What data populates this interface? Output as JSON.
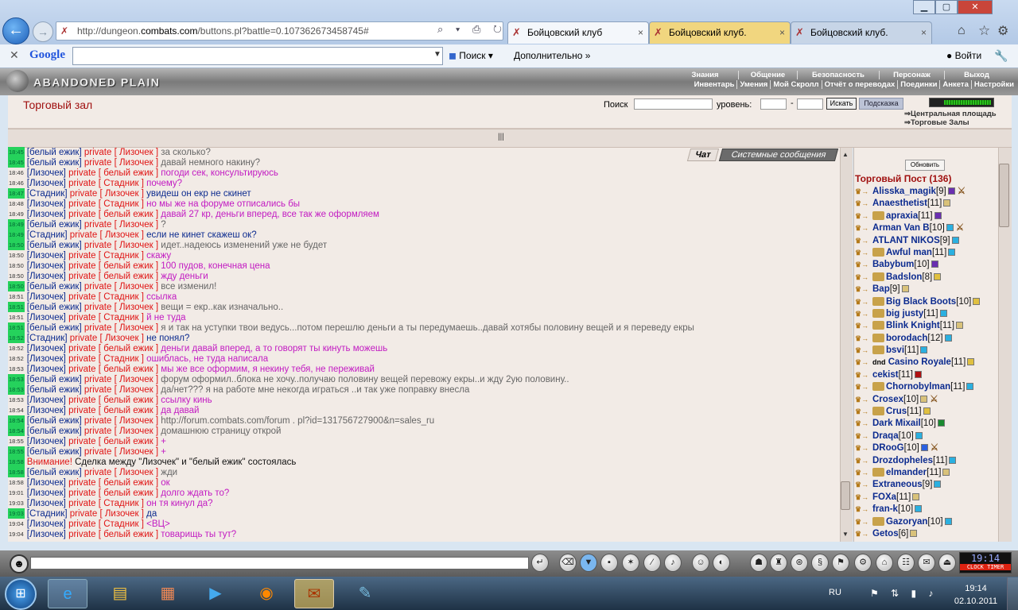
{
  "browser": {
    "url_prefix": "http://dungeon.",
    "url_domain": "combats.com",
    "url_suffix": "/buttons.pl?battle=0.107362673458745#",
    "tabs": [
      {
        "label": "Бойцовский клуб"
      },
      {
        "label": "Бойцовский клуб."
      },
      {
        "label": "Бойцовский клуб."
      }
    ]
  },
  "google": {
    "logo": "Google",
    "search_label": "Поиск",
    "more_label": "Дополнительно",
    "login_label": "Войти"
  },
  "game": {
    "logo": "ABANDONED PLAIN",
    "menu_top": [
      "Знания",
      "Общение",
      "Безопасность",
      "Персонаж",
      "Выход"
    ],
    "menu_bottom": [
      "Инвентарь",
      "Умения",
      "Мой Скролл",
      "Отчёт о переводах",
      "Поединки",
      "Анкета",
      "Настройки"
    ],
    "room_title": "Торговый зал",
    "search_label": "Поиск",
    "level_label": "уровень:",
    "dash": "-",
    "find_button": "Искать",
    "hint_button": "Подсказка",
    "link_central": "Центральная площадь",
    "link_trade": "Торговые Залы",
    "hp_fraction": 0.95,
    "chat_tab": "Чат",
    "system_tab": "Системные сообщения",
    "refresh_button": "Обновить",
    "players_title": "Торговый Пост (136)"
  },
  "chat": [
    {
      "t": "18:45",
      "a": "белый ежик",
      "b": "Лизочек",
      "m": "за сколько?",
      "c": "mg",
      "g": true
    },
    {
      "t": "18:45",
      "a": "белый ежик",
      "b": "Лизочек",
      "m": "давай немного накину?",
      "c": "mg",
      "g": true
    },
    {
      "t": "18:46",
      "a": "Лизочек",
      "b": "белый ежик",
      "m": "погоди сек, консультируюсь",
      "c": "mv",
      "g": false
    },
    {
      "t": "18:46",
      "a": "Лизочек",
      "b": "Стадник",
      "m": "почему?",
      "c": "mv",
      "g": false
    },
    {
      "t": "18:47",
      "a": "Стадник",
      "b": "Лизочек",
      "m": "увидеш он екр не скинет",
      "c": "ms",
      "g": true
    },
    {
      "t": "18:48",
      "a": "Лизочек",
      "b": "Стадник",
      "m": "но мы же на форуме отписались бы",
      "c": "mv",
      "g": false
    },
    {
      "t": "18:49",
      "a": "Лизочек",
      "b": "белый ежик",
      "m": "давай 27 кр, деньги вперед, все так же оформляем",
      "c": "mv",
      "g": false
    },
    {
      "t": "18:49",
      "a": "белый ежик",
      "b": "Лизочек",
      "m": "?",
      "c": "mg",
      "g": true
    },
    {
      "t": "18:49",
      "a": "Стадник",
      "b": "Лизочек",
      "m": "если не кинет скажеш ок?",
      "c": "ms",
      "g": true
    },
    {
      "t": "18:50",
      "a": "белый ежик",
      "b": "Лизочек",
      "m": "идет..надеюсь изменений уже не будет",
      "c": "mg",
      "g": true
    },
    {
      "t": "18:50",
      "a": "Лизочек",
      "b": "Стадник",
      "m": "скажу",
      "c": "mv",
      "g": false
    },
    {
      "t": "18:50",
      "a": "Лизочек",
      "b": "белый ежик",
      "m": "100 пудов, конечная цена",
      "c": "mv",
      "g": false
    },
    {
      "t": "18:50",
      "a": "Лизочек",
      "b": "белый ежик",
      "m": "жду деньги",
      "c": "mv",
      "g": false
    },
    {
      "t": "18:50",
      "a": "белый ежик",
      "b": "Лизочек",
      "m": "все изменил!",
      "c": "mg",
      "g": true
    },
    {
      "t": "18:51",
      "a": "Лизочек",
      "b": "Стадник",
      "m": "ссылка",
      "c": "mv",
      "g": false
    },
    {
      "t": "18:51",
      "a": "белый ежик",
      "b": "Лизочек",
      "m": "вещи = екр..как изначально..",
      "c": "mg",
      "g": true
    },
    {
      "t": "18:51",
      "a": "Лизочек",
      "b": "Стадник",
      "m": "й не туда",
      "c": "mv",
      "g": false
    },
    {
      "t": "18:51",
      "a": "белый ежик",
      "b": "Лизочек",
      "m": "я и так на уступки твои ведусь...потом перешлю деньги а ты передумаешь..давай хотябы половину вещей и я переведу екры",
      "c": "mg",
      "g": true
    },
    {
      "t": "18:52",
      "a": "Стадник",
      "b": "Лизочек",
      "m": "не понял?",
      "c": "ms",
      "g": true
    },
    {
      "t": "18:52",
      "a": "Лизочек",
      "b": "белый ежик",
      "m": "деньги давай вперед, а то говорят ты кинуть можешь",
      "c": "mv",
      "g": false
    },
    {
      "t": "18:52",
      "a": "Лизочек",
      "b": "Стадник",
      "m": "ошиблась, не туда написала",
      "c": "mv",
      "g": false
    },
    {
      "t": "18:53",
      "a": "Лизочек",
      "b": "белый ежик",
      "m": "мы же все оформим, я некину тебя, не переживай",
      "c": "mv",
      "g": false
    },
    {
      "t": "18:53",
      "a": "белый ежик",
      "b": "Лизочек",
      "m": "форум оформил..блока не хочу..получаю половину вещей перевожу екры..и жду 2ую половину..",
      "c": "mg",
      "g": true
    },
    {
      "t": "18:53",
      "a": "белый ежик",
      "b": "Лизочек",
      "m": "да/нет??? я на работе мне некогда играться ..и так уже поправку внесла",
      "c": "mg",
      "g": true
    },
    {
      "t": "18:53",
      "a": "Лизочек",
      "b": "белый ежик",
      "m": "ссылку кинь",
      "c": "mv",
      "g": false
    },
    {
      "t": "18:54",
      "a": "Лизочек",
      "b": "белый ежик",
      "m": "да давай",
      "c": "mv",
      "g": false
    },
    {
      "t": "18:54",
      "a": "белый ежик",
      "b": "Лизочек",
      "m": "http://forum.combats.com/forum . pl?id=131756727900&n=sales_ru",
      "c": "mg",
      "g": true
    },
    {
      "t": "18:54",
      "a": "белый ежик",
      "b": "Лизочек",
      "m": "домашнюю страницу открой",
      "c": "mg",
      "g": true
    },
    {
      "t": "18:55",
      "a": "Лизочек",
      "b": "белый ежик",
      "m": "+",
      "c": "mv",
      "g": false
    },
    {
      "t": "18:55",
      "a": "белый ежик",
      "b": "Лизочек",
      "m": "+",
      "c": "mv",
      "g": true
    },
    {
      "t": "18:58",
      "warn": "Внимание!",
      "m": "Сделка между \"Лизочек\" и \"белый ежик\" состоялась",
      "c": "ms2",
      "g": true
    },
    {
      "t": "18:58",
      "a": "белый ежик",
      "b": "Лизочек",
      "m": "жди",
      "c": "mg",
      "g": true
    },
    {
      "t": "18:58",
      "a": "Лизочек",
      "b": "белый ежик",
      "m": "ок",
      "c": "mv",
      "g": false
    },
    {
      "t": "19:01",
      "a": "Лизочек",
      "b": "белый ежик",
      "m": "долго ждать то?",
      "c": "mv",
      "g": false
    },
    {
      "t": "19:03",
      "a": "Лизочек",
      "b": "Стадник",
      "m": "он тя кинул да?",
      "c": "mv",
      "g": false
    },
    {
      "t": "19:03",
      "a": "Стадник",
      "b": "Лизочек",
      "m": "да",
      "c": "ms",
      "g": true
    },
    {
      "t": "19:04",
      "a": "Лизочек",
      "b": "Стадник",
      "m": "<ВЦ>",
      "c": "mv",
      "g": false
    },
    {
      "t": "19:04",
      "a": "Лизочек",
      "b": "белый ежик",
      "m": "товарищь ты тут?",
      "c": "mv",
      "g": false
    }
  ],
  "chat_labels": {
    "private": "private"
  },
  "players": [
    {
      "n": "Aliss­ka_magik",
      "l": "[9]",
      "s": "#6a2fb0",
      "sw": true
    },
    {
      "n": "Anaesthetist",
      "l": "[11]",
      "s": "#d9c27a"
    },
    {
      "n": "apraxia",
      "l": "[11]",
      "s": "#6a2fb0",
      "cl": true
    },
    {
      "n": "Arman Van B",
      "l": "[10]",
      "s": "#2bb0e0",
      "sw": true
    },
    {
      "n": "ATLANT NIKOS",
      "l": "[9]",
      "s": "#2bb0e0"
    },
    {
      "n": "Awful man",
      "l": "[11]",
      "s": "#2bb0e0",
      "cl": true
    },
    {
      "n": "Babybum",
      "l": "[10]",
      "s": "#6a2fb0"
    },
    {
      "n": "Badslon",
      "l": "[8]",
      "s": "#e0c040",
      "cl": true
    },
    {
      "n": "Bap",
      "l": "[9]",
      "s": "#d9c27a"
    },
    {
      "n": "Big Black Boots",
      "l": "[10]",
      "s": "#e0c040",
      "cl": true
    },
    {
      "n": "big justy",
      "l": "[11]",
      "s": "#2bb0e0",
      "cl": true
    },
    {
      "n": "Blink Knight",
      "l": "[11]",
      "s": "#d9c27a",
      "cl": true
    },
    {
      "n": "borodach",
      "l": "[12]",
      "s": "#2bb0e0",
      "cl": true
    },
    {
      "n": "bsvi",
      "l": "[11]",
      "s": "#2bb0e0",
      "cl": true
    },
    {
      "n": "Casino Royale",
      "l": "[11]",
      "s": "#e0c040",
      "pre": "dnd"
    },
    {
      "n": "cekist",
      "l": "[11]",
      "s": "#b01010"
    },
    {
      "n": "Chornobylman",
      "l": "[11]",
      "s": "#2bb0e0",
      "cl": true
    },
    {
      "n": "Crosex",
      "l": "[10]",
      "s": "#d9c27a",
      "sw": true
    },
    {
      "n": "Crus",
      "l": "[11]",
      "s": "#e0c040",
      "cl": true
    },
    {
      "n": "Dark Mixail",
      "l": "[10]",
      "s": "#1a8a30"
    },
    {
      "n": "Draqa",
      "l": "[10]",
      "s": "#2bb0e0"
    },
    {
      "n": "DRooG",
      "l": "[10]",
      "s": "#2b60e0",
      "sw": true
    },
    {
      "n": "Drozdopheles",
      "l": "[11]",
      "s": "#2bb0e0"
    },
    {
      "n": "elmander",
      "l": "[11]",
      "s": "#d9c27a",
      "cl": true
    },
    {
      "n": "Extraneous",
      "l": "[9]",
      "s": "#2bb0e0"
    },
    {
      "n": "FOXa",
      "l": "[11]",
      "s": "#d9c27a"
    },
    {
      "n": "fran-k",
      "l": "[10]",
      "s": "#2bb0e0"
    },
    {
      "n": "Gazoryan",
      "l": "[10]",
      "s": "#2bb0e0",
      "cl": true
    },
    {
      "n": "Getos",
      "l": "[6]",
      "s": "#d9c27a"
    }
  ],
  "bottom_clock": "19:14",
  "clock_label": "CLOCK TIMER",
  "taskbar": {
    "lang": "RU",
    "time": "19:14",
    "date": "02.10.2011"
  },
  "colors": {
    "accent": "#a01010",
    "chat_nick": "#0c2b8f",
    "private": "#e01515",
    "magenta": "#c21ac2",
    "time_green": "#25d25c"
  }
}
